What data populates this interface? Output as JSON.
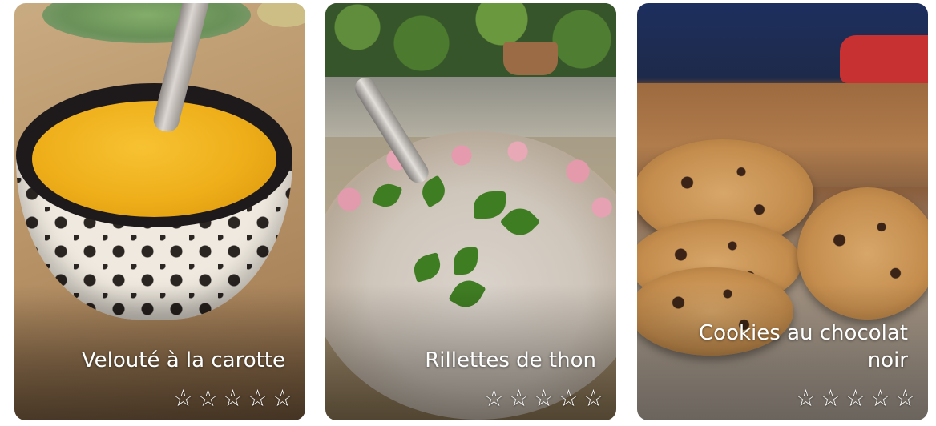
{
  "recipes": [
    {
      "title": "Velouté à la carotte",
      "image_subject": "carrot soup in a patterned bowl",
      "rating": {
        "value": 0,
        "max": 5,
        "stars": [
          "☆",
          "☆",
          "☆",
          "☆",
          "☆"
        ]
      }
    },
    {
      "title": "Rillettes de thon",
      "image_subject": "tuna rillettes with parsley in a flowered dish",
      "rating": {
        "value": 0,
        "max": 5,
        "stars": [
          "☆",
          "☆",
          "☆",
          "☆",
          "☆"
        ]
      }
    },
    {
      "title": "Cookies au chocolat noir",
      "image_subject": "stack of dark chocolate cookies",
      "rating": {
        "value": 0,
        "max": 5,
        "stars": [
          "☆",
          "☆",
          "☆",
          "☆",
          "☆"
        ]
      }
    }
  ],
  "colors": {
    "title_text": "#ffffff",
    "star_outline": "#ffffff"
  }
}
